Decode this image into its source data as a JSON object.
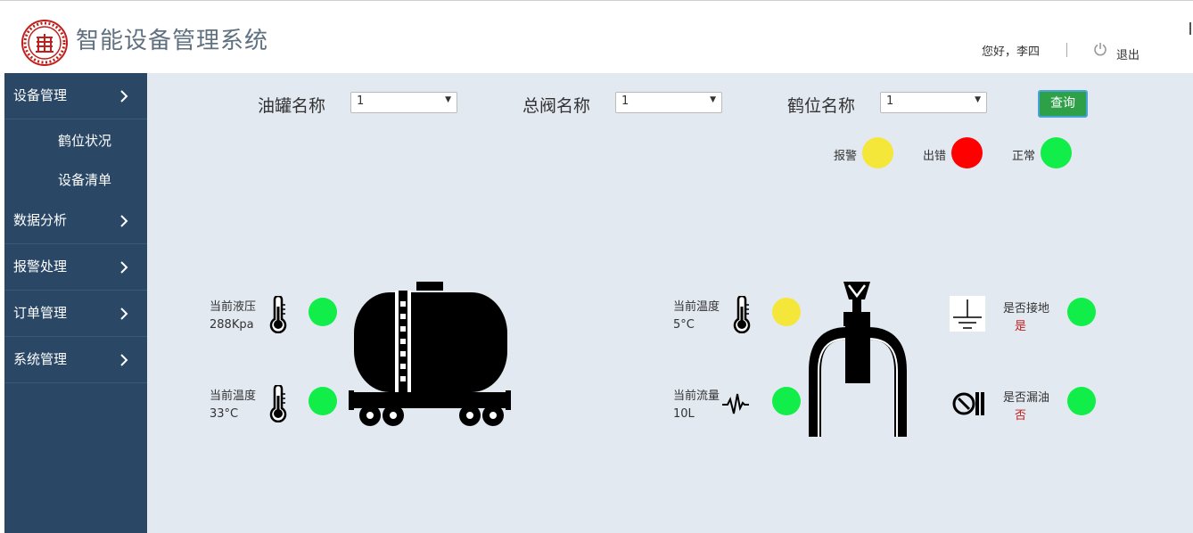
{
  "header": {
    "logo_text": "西安交通大学",
    "title": "智能设备管理系统",
    "greeting": "您好，李四",
    "logout_label": "退出",
    "power_icon": "power-icon"
  },
  "sidebar": {
    "items": [
      {
        "label": "设备管理",
        "expanded": true
      },
      {
        "label": "鹤位状况"
      },
      {
        "label": "设备清单"
      },
      {
        "label": "数据分析"
      },
      {
        "label": "报警处理"
      },
      {
        "label": "订单管理"
      },
      {
        "label": "系统管理"
      }
    ],
    "bg_color": "#2a4766"
  },
  "filters": {
    "tank_label": "油罐名称",
    "tank_value": "1",
    "valve_label": "总阀名称",
    "valve_value": "1",
    "crane_label": "鹤位名称",
    "crane_value": "1",
    "query_label": "查询"
  },
  "legend": {
    "alarm_label": "报警",
    "alarm_color": "#f5e63a",
    "error_label": "出错",
    "error_color": "#ff0000",
    "normal_label": "正常",
    "normal_color": "#11ee4a"
  },
  "tank": {
    "pressure_label": "当前液压",
    "pressure_value": "288Kpa",
    "pressure_status": "normal",
    "temp_label": "当前温度",
    "temp_value": "33°C",
    "temp_status": "normal",
    "icons": [
      "thermometer-icon",
      "tank-car-icon"
    ]
  },
  "crane": {
    "temp_label": "当前温度",
    "temp_value": "5°C",
    "temp_status": "alarm",
    "flow_label": "当前流量",
    "flow_value": "10L",
    "flow_status": "normal",
    "ground_label": "是否接地",
    "ground_value": "是",
    "ground_status": "normal",
    "leak_label": "是否漏油",
    "leak_value": "否",
    "leak_status": "normal",
    "icons": [
      "loading-arm-icon",
      "ground-icon",
      "valve-icon",
      "pulse-icon"
    ]
  }
}
